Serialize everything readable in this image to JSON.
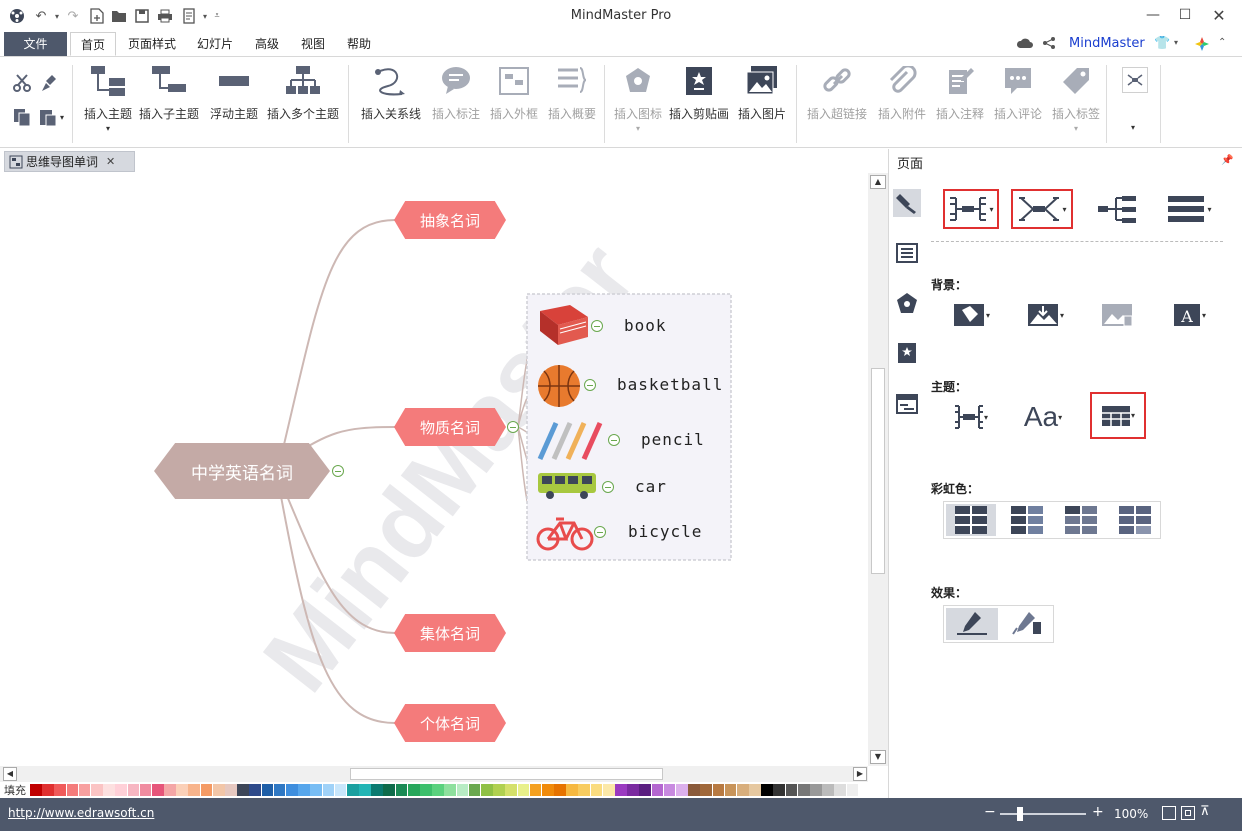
{
  "app": {
    "title": "MindMaster Pro"
  },
  "menu": {
    "file": "文件",
    "tabs": [
      "首页",
      "页面样式",
      "幻灯片",
      "高级",
      "视图",
      "帮助"
    ],
    "account": "MindMaster"
  },
  "ribbon": {
    "insert_topic": "插入主题",
    "insert_subtopic": "插入子主题",
    "floating_topic": "浮动主题",
    "insert_multi": "插入多个主题",
    "insert_relation": "插入关系线",
    "insert_callout": "插入标注",
    "insert_boundary": "插入外框",
    "insert_summary": "插入概要",
    "insert_icon": "插入图标",
    "insert_clipart": "插入剪贴画",
    "insert_image": "插入图片",
    "insert_hyperlink": "插入超链接",
    "insert_attachment": "插入附件",
    "insert_note": "插入注释",
    "insert_comment": "插入评论",
    "insert_tag": "插入标签"
  },
  "doc_tab": {
    "name": "思维导图单词"
  },
  "mindmap": {
    "watermark": "MindMaster",
    "central": "中学英语名词",
    "branches": [
      "抽象名词",
      "物质名词",
      "集体名词",
      "个体名词"
    ],
    "leaves": [
      "book",
      "basketball",
      "pencil",
      "car",
      "bicycle"
    ]
  },
  "panel": {
    "title": "页面",
    "background": "背景：",
    "theme": "主题：",
    "rainbow": "彩虹色：",
    "effect": "效果："
  },
  "palette": {
    "label": "填充"
  },
  "status": {
    "url": "http://www.edrawsoft.cn",
    "zoom": "100%"
  },
  "colors": {
    "accent_dark": "#4e586b",
    "branch_node": "#f47b7b",
    "central_node": "#c4aaa6",
    "highlight_red": "#e03030"
  }
}
